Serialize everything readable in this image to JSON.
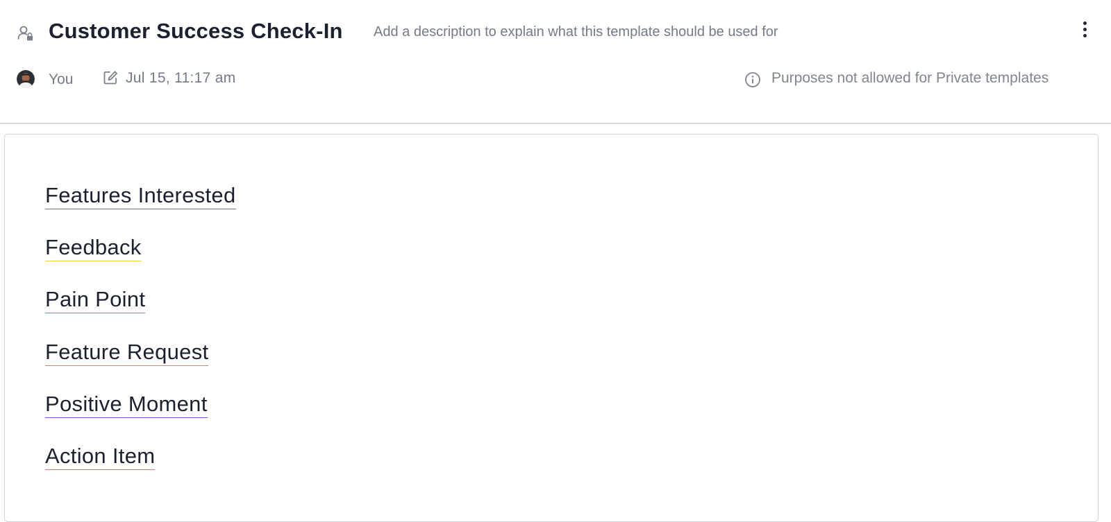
{
  "header": {
    "title": "Customer Success Check-In",
    "description_placeholder": "Add a description to explain what this template should be used for",
    "privacy_icon": "person-lock-icon",
    "menu_icon": "kebab-menu-icon"
  },
  "meta": {
    "owner": "You",
    "edited_at": "Jul 15, 11:17 am",
    "edit_icon": "edit-icon",
    "info_icon": "info-icon",
    "purposes_notice": "Purposes not allowed for Private templates"
  },
  "tags": [
    {
      "label": "Features Interested",
      "color": "#6b7280"
    },
    {
      "label": "Feedback",
      "color": "#f2d24b"
    },
    {
      "label": "Pain Point",
      "color": "#e8557f"
    },
    {
      "label": "Feature Request",
      "color": "#f0745e"
    },
    {
      "label": "Positive Moment",
      "color": "#7c4dcc"
    },
    {
      "label": "Action Item",
      "color": "#3ac26a"
    }
  ]
}
